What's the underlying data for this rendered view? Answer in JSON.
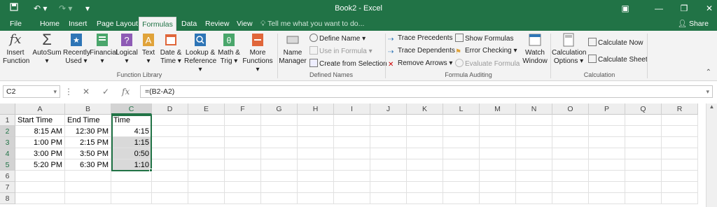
{
  "titlebar": {
    "title": "Book2 - Excel",
    "window_buttons": [
      "▣",
      "—",
      "❐",
      "✕"
    ]
  },
  "tabs": [
    "File",
    "Home",
    "Insert",
    "Page Layout",
    "Formulas",
    "Data",
    "Review",
    "View"
  ],
  "active_tab": "Formulas",
  "tell_me": "Tell me what you want to do...",
  "share": "Share",
  "ribbon": {
    "function_library": {
      "insert_function": [
        "Insert",
        "Function"
      ],
      "autosum": "AutoSum",
      "recently_used": [
        "Recently",
        "Used"
      ],
      "financial": "Financial",
      "logical": "Logical",
      "text": "Text",
      "date_time": [
        "Date &",
        "Time"
      ],
      "lookup_reference": [
        "Lookup &",
        "Reference"
      ],
      "math_trig": [
        "Math &",
        "Trig"
      ],
      "more_functions": [
        "More",
        "Functions"
      ],
      "label": "Function Library"
    },
    "defined_names": {
      "name_manager": [
        "Name",
        "Manager"
      ],
      "define_name": "Define Name",
      "use_in_formula": "Use in Formula",
      "create_from_selection": "Create from Selection",
      "label": "Defined Names"
    },
    "formula_auditing": {
      "trace_precedents": "Trace Precedents",
      "trace_dependents": "Trace Dependents",
      "remove_arrows": "Remove Arrows",
      "show_formulas": "Show Formulas",
      "error_checking": "Error Checking",
      "evaluate_formula": "Evaluate Formula",
      "watch_window": [
        "Watch",
        "Window"
      ],
      "label": "Formula Auditing"
    },
    "calculation": {
      "calculation_options": [
        "Calculation",
        "Options"
      ],
      "calculate_now": "Calculate Now",
      "calculate_sheet": "Calculate Sheet",
      "label": "Calculation"
    }
  },
  "formula_bar": {
    "name_box": "C2",
    "formula": "=(B2-A2)"
  },
  "sheet": {
    "columns": [
      "A",
      "B",
      "C",
      "D",
      "E",
      "F",
      "G",
      "H",
      "I",
      "J",
      "K",
      "L",
      "M",
      "N",
      "O",
      "P",
      "Q",
      "R"
    ],
    "rows": [
      "1",
      "2",
      "3",
      "4",
      "5",
      "6",
      "7",
      "8"
    ],
    "cells": [
      [
        "Start Time",
        "End Time",
        "Time"
      ],
      [
        "8:15 AM",
        "12:30 PM",
        "4:15"
      ],
      [
        "1:00 PM",
        "2:15 PM",
        "1:15"
      ],
      [
        "3:00 PM",
        "3:50 PM",
        "0:50"
      ],
      [
        "5:20 PM",
        "6:30 PM",
        "1:10"
      ]
    ]
  },
  "colors": {
    "accent": "#217346",
    "selection_fill": "#d9d9d9"
  }
}
